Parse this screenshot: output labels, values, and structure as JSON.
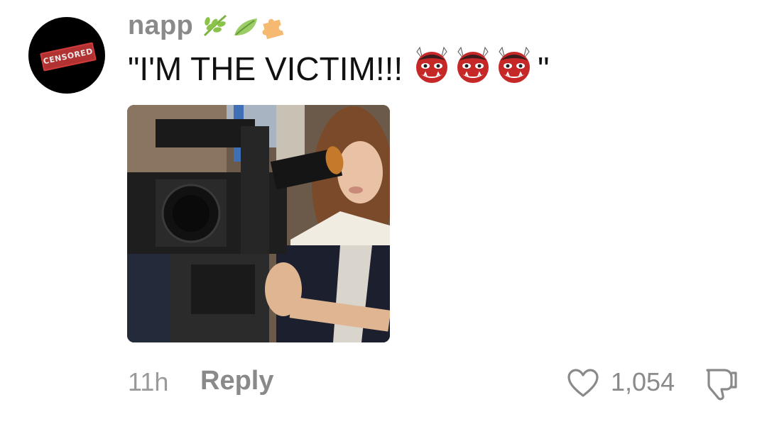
{
  "comment": {
    "avatar_stamp_text": "CENSORED",
    "username": "napp",
    "badges": [
      "herb-icon",
      "leaf-icon",
      "puzzle-icon"
    ],
    "text_before": "\"I'M THE VICTIM!!!",
    "emojis": [
      "ogre-icon",
      "ogre-icon",
      "ogre-icon"
    ],
    "text_after": "\"",
    "image_description_icon": "photo-attachment",
    "timestamp": "11h",
    "reply_label": "Reply",
    "like_count": "1,054"
  },
  "colors": {
    "muted_text": "#8a8a8a",
    "body_text": "#111111",
    "stamp_red": "#d13b3b"
  }
}
